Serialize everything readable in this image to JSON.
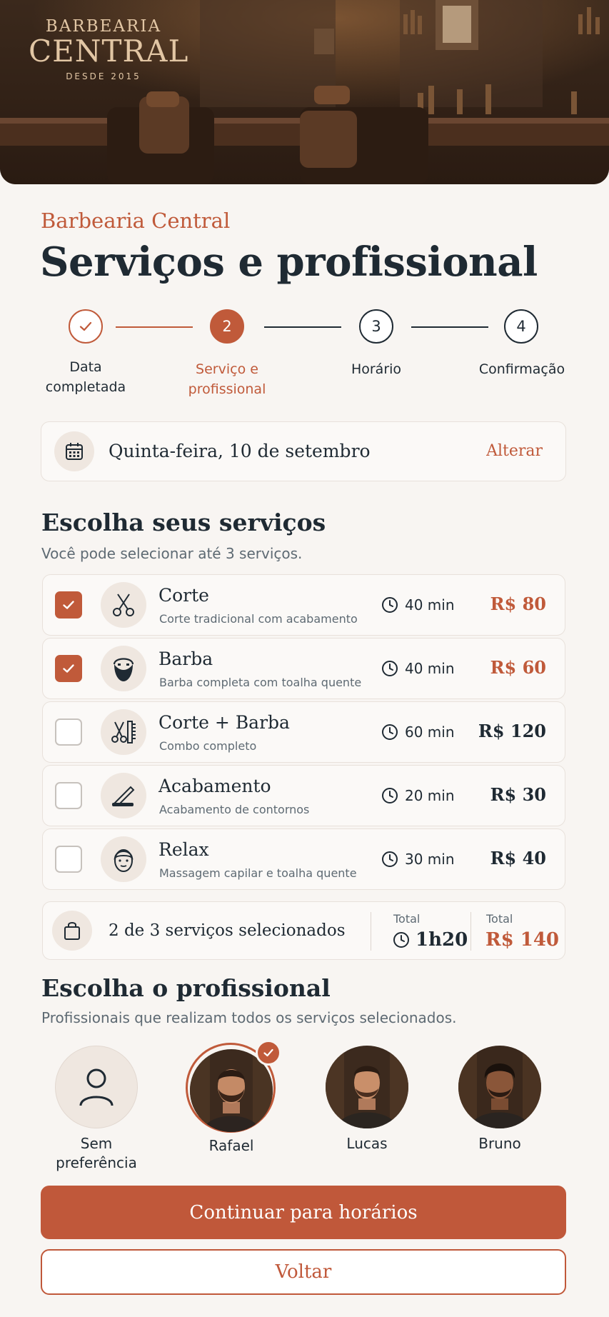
{
  "hero": {
    "sign_line1": "BARBEARIA",
    "sign_line2": "CENTRAL",
    "sign_line3": "DESDE 2015"
  },
  "header": {
    "brand": "Barbearia Central",
    "title": "Serviços e profissional"
  },
  "stepper": {
    "steps": [
      {
        "number": "",
        "label": "Data completada",
        "state": "done"
      },
      {
        "number": "2",
        "label": "Serviço e profissional",
        "state": "active"
      },
      {
        "number": "3",
        "label": "Horário",
        "state": "upcoming"
      },
      {
        "number": "4",
        "label": "Confirmação",
        "state": "upcoming"
      }
    ]
  },
  "date_card": {
    "date": "Quinta-feira, 10 de setembro",
    "change_label": "Alterar"
  },
  "services_section": {
    "title": "Escolha seus serviços",
    "subtitle": "Você pode selecionar até 3 serviços.",
    "items": [
      {
        "name": "Corte",
        "description": "Corte tradicional com acabamento",
        "duration": "40 min",
        "price": "R$ 80",
        "selected": true,
        "icon": "scissors-icon"
      },
      {
        "name": "Barba",
        "description": "Barba completa com toalha quente",
        "duration": "40 min",
        "price": "R$ 60",
        "selected": true,
        "icon": "beard-icon"
      },
      {
        "name": "Corte + Barba",
        "description": "Combo completo",
        "duration": "60 min",
        "price": "R$ 120",
        "selected": false,
        "icon": "scissors-comb-icon"
      },
      {
        "name": "Acabamento",
        "description": "Acabamento de contornos",
        "duration": "20 min",
        "price": "R$ 30",
        "selected": false,
        "icon": "razor-icon"
      },
      {
        "name": "Relax",
        "description": "Massagem capilar e toalha quente",
        "duration": "30 min",
        "price": "R$ 40",
        "selected": false,
        "icon": "face-towel-icon"
      }
    ]
  },
  "summary": {
    "selected_text": "2 de 3 serviços selecionados",
    "duration_label": "Total",
    "duration_value": "1h20",
    "price_label": "Total",
    "price_value": "R$ 140"
  },
  "professionals_section": {
    "title": "Escolha o profissional",
    "subtitle": "Profissionais que realizam todos os serviços selecionados.",
    "items": [
      {
        "name": "Sem preferência",
        "selected": false
      },
      {
        "name": "Rafael",
        "selected": true
      },
      {
        "name": "Lucas",
        "selected": false
      },
      {
        "name": "Bruno",
        "selected": false
      }
    ]
  },
  "actions": {
    "continue_label": "Continuar para horários",
    "back_label": "Voltar"
  },
  "colors": {
    "accent": "#c05a3a",
    "text": "#1f2a33",
    "background": "#f8f5f2"
  }
}
